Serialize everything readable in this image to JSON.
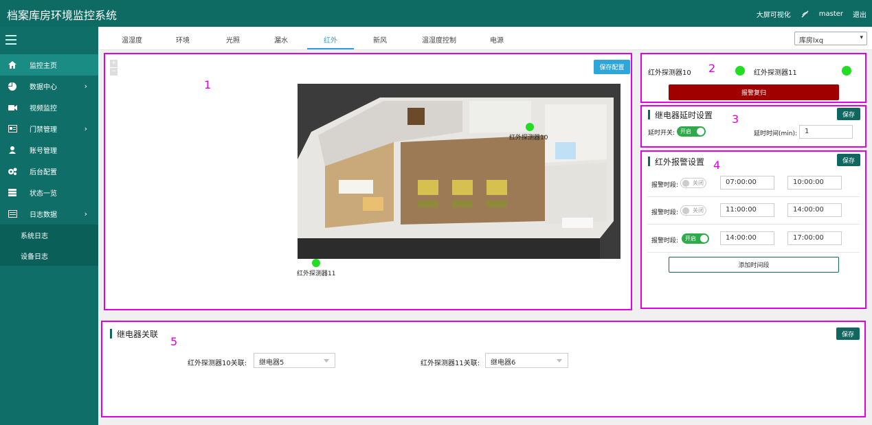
{
  "header": {
    "title": "档案库房环境监控系统",
    "bigscreen_label": "大屏可视化",
    "user": "master",
    "logout_label": "退出"
  },
  "sidebar": {
    "items": [
      {
        "label": "监控主页",
        "icon": "home-icon"
      },
      {
        "label": "数据中心",
        "icon": "pie-chart-icon"
      },
      {
        "label": "视频监控",
        "icon": "video-camera-icon"
      },
      {
        "label": "门禁管理",
        "icon": "id-card-icon"
      },
      {
        "label": "账号管理",
        "icon": "user-icon"
      },
      {
        "label": "后台配置",
        "icon": "gears-icon"
      },
      {
        "label": "状态一览",
        "icon": "server-icon"
      },
      {
        "label": "日志数据",
        "icon": "list-icon"
      }
    ],
    "subitems": [
      "系统日志",
      "设备日志"
    ]
  },
  "tabs": [
    "温湿度",
    "环境",
    "光照",
    "漏水",
    "红外",
    "新风",
    "温湿度控制",
    "电源"
  ],
  "room_select": "库房lxq",
  "annotations": [
    "1",
    "2",
    "3",
    "4",
    "5"
  ],
  "map": {
    "save_label": "保存配置",
    "zoom_in": "+",
    "zoom_out": "−",
    "sensor10_label": "红外探测器10",
    "sensor11_label": "红外探测器11"
  },
  "status": {
    "sensor10": "红外探测器10",
    "sensor11": "红外探测器11",
    "reset_label": "报警复归",
    "status_color": "#22dd22"
  },
  "relay_delay": {
    "title": "继电器延时设置",
    "save_label": "保存",
    "switch_label": "延时开关:",
    "switch_state": "开启",
    "time_label": "延时时间(min):",
    "time_value": "1"
  },
  "alarm": {
    "title": "红外报警设置",
    "save_label": "保存",
    "period_label": "报警时段:",
    "periods": [
      {
        "state": "关闭",
        "start": "07:00:00",
        "end": "10:00:00"
      },
      {
        "state": "关闭",
        "start": "11:00:00",
        "end": "14:00:00"
      },
      {
        "state": "开启",
        "start": "14:00:00",
        "end": "17:00:00"
      }
    ],
    "add_label": "添加时间段"
  },
  "relay_link": {
    "title": "继电器关联",
    "save_label": "保存",
    "sensor10_label": "红外探测器10关联:",
    "sensor10_value": "继电器5",
    "sensor11_label": "红外探测器11关联:",
    "sensor11_value": "继电器6"
  }
}
